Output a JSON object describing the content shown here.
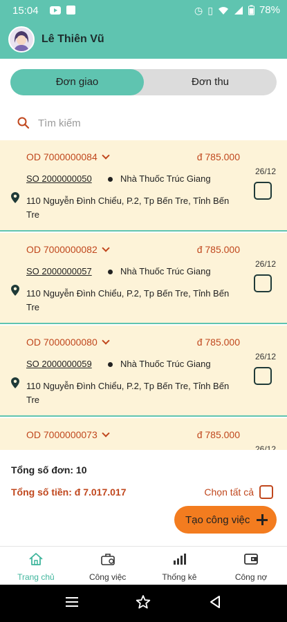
{
  "status_bar": {
    "time": "15:04",
    "battery": "78%",
    "alarm_icon": "⏰",
    "vibrate_icon": "📳",
    "wifi_icon": "wifi-icon",
    "signal_icon": "signal-icon"
  },
  "header": {
    "user_name": "Lê Thiên Vũ"
  },
  "tabs": [
    {
      "label": "Đơn giao",
      "active": true
    },
    {
      "label": "Đơn thu",
      "active": false
    }
  ],
  "search": {
    "placeholder": "Tìm kiếm",
    "value": ""
  },
  "orders": [
    {
      "code": "OD 7000000084",
      "amount": "đ 785.000",
      "so": "SO 2000000050",
      "store": "Nhà Thuốc Trúc Giang",
      "date": "26/12",
      "address": "110 Nguyễn Đình Chiểu, P.2, Tp Bến Tre, Tỉnh Bến Tre",
      "checked": false
    },
    {
      "code": "OD 7000000082",
      "amount": "đ 785.000",
      "so": "SO 2000000057",
      "store": "Nhà Thuốc Trúc Giang",
      "date": "26/12",
      "address": "110 Nguyễn Đình Chiểu, P.2, Tp Bến Tre, Tỉnh Bến Tre",
      "checked": false
    },
    {
      "code": "OD 7000000080",
      "amount": "đ 785.000",
      "so": "SO 2000000059",
      "store": "Nhà Thuốc Trúc Giang",
      "date": "26/12",
      "address": "110 Nguyễn Đình Chiểu, P.2, Tp Bến Tre, Tỉnh Bến Tre",
      "checked": false
    },
    {
      "code": "OD 7000000073",
      "amount": "đ 785.000",
      "so": "",
      "store": "",
      "date": "26/12",
      "address": "",
      "checked": false
    }
  ],
  "summary": {
    "total_orders": "Tổng số đơn: 10",
    "total_money": "Tổng số tiền: đ 7.017.017",
    "select_all": "Chọn tất cả",
    "create_button": "Tạo công việc"
  },
  "bottom_nav": [
    {
      "label": "Trang chủ",
      "icon": "home-icon",
      "active": true
    },
    {
      "label": "Công việc",
      "icon": "briefcase-icon",
      "active": false
    },
    {
      "label": "Thống kê",
      "icon": "bar-chart-icon",
      "active": false
    },
    {
      "label": "Công nợ",
      "icon": "wallet-icon",
      "active": false
    }
  ],
  "colors": {
    "primary": "#5fc4b0",
    "accent_text": "#c0471d",
    "card_bg": "#fdf3d8",
    "button_orange": "#f37c1f"
  }
}
